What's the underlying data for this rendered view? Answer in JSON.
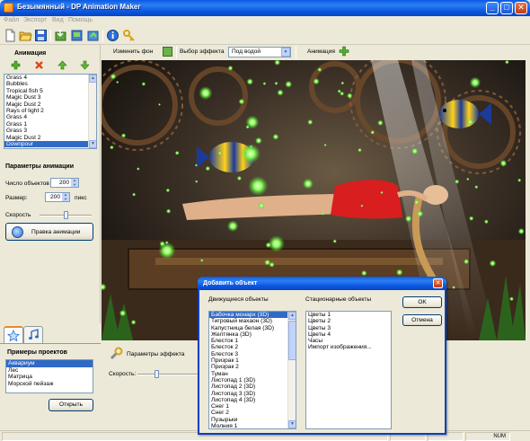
{
  "window": {
    "title": "Безымянный - DP Animation Maker",
    "buttons": {
      "minimize": "_",
      "maximize": "□",
      "close": "✕"
    }
  },
  "menu": [
    "Файл",
    "Экспорт",
    "Вид",
    "Помощь"
  ],
  "toolbar": {
    "icons": [
      "new-file-icon",
      "open-folder-icon",
      "save-icon",
      "import-icon",
      "export-icon",
      "share-icon",
      "info-icon",
      "key-icon"
    ]
  },
  "animation_panel": {
    "title": "Анимация",
    "tool_icons": [
      "add-icon",
      "delete-icon",
      "move-up-icon",
      "move-down-icon"
    ],
    "items": [
      "Grass 4",
      "Bubbles",
      "Tropical fish 5",
      "Magic Dust 3",
      "Magic Dust 2",
      "Rays of light 2",
      "Grass 4",
      "Grass 1",
      "Grass 3",
      "Magic Dust 2",
      "Downpour"
    ],
    "selected_index": 10
  },
  "params": {
    "title": "Параметры анимации",
    "count_label": "Число объектов",
    "count_value": "200",
    "size_label": "Размер:",
    "size_value": "200",
    "size_unit": "пикс",
    "speed_label": "Скорость",
    "speed_fraction": 0.5,
    "edit_button": "Правка анимации"
  },
  "effect_bar": {
    "change_bg_label": "Изменить фон",
    "effect_select_label": "Выбор эффекта",
    "effect_value": "Под водой",
    "animation_label": "Анимация"
  },
  "projects": {
    "tab_icons": [
      "star-icon",
      "music-note-icon"
    ],
    "title": "Примеры проектов",
    "items": [
      "Аквариум",
      "Лес",
      "Матрица",
      "Морской пейзаж"
    ],
    "selected_index": 0,
    "open_button": "Открыть"
  },
  "effect_params": {
    "title": "Параметры эффекта",
    "speed_label": "Скорость:",
    "speed_fraction": 0.3
  },
  "dialog": {
    "title": "Добавить объект",
    "moving_label": "Движущиеся объекты",
    "moving_items": [
      "Бабочка монарх (3D)",
      "Тигровый махаон (3D)",
      "Капустница белая (3D)",
      "Желтянка (3D)",
      "Блесток 1",
      "Блесток 2",
      "Блесток 3",
      "Призрак 1",
      "Призрак 2",
      "Туман",
      "Листопад 1 (3D)",
      "Листопад 2 (3D)",
      "Листопад 3 (3D)",
      "Листопад 4 (3D)",
      "Снег 1",
      "Снег 2",
      "Пузырьки",
      "Молния 1"
    ],
    "moving_selected": 0,
    "static_label": "Стационарные объекты",
    "static_items": [
      "Цветы 1",
      "Цветы 2",
      "Цветы 3",
      "Цветы 4",
      "Часы",
      "Импорт изображения..."
    ],
    "ok_button": "OK",
    "cancel_button": "Отмена"
  },
  "status": {
    "num": "NUM"
  },
  "colors": {
    "selection": "#316ac5",
    "title_blue": "#0b56de",
    "dress_red": "#d81e1e",
    "glow_green": "#7dff5a"
  }
}
